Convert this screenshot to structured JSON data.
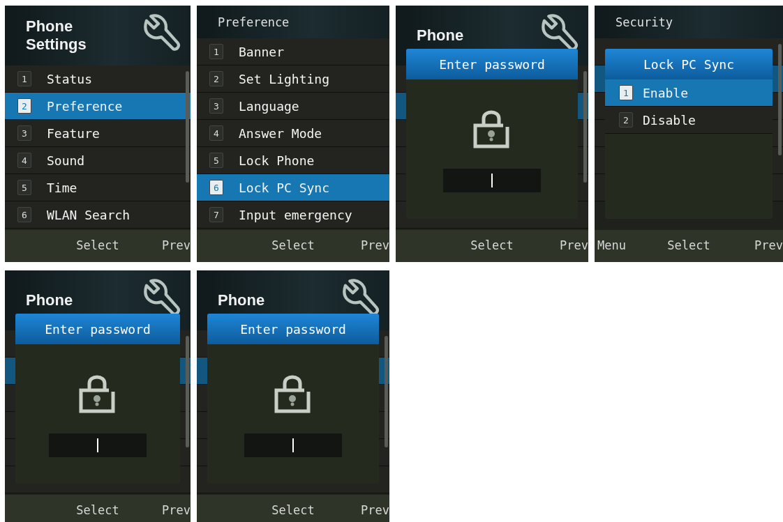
{
  "screens": [
    {
      "kind": "menu",
      "title": "Phone Settings",
      "wrench": true,
      "scrollbar": true,
      "items": [
        {
          "number": "1",
          "label": "Status",
          "selected": false
        },
        {
          "number": "2",
          "label": "Preference",
          "selected": true
        },
        {
          "number": "3",
          "label": "Feature",
          "selected": false
        },
        {
          "number": "4",
          "label": "Sound",
          "selected": false
        },
        {
          "number": "5",
          "label": "Time",
          "selected": false
        },
        {
          "number": "6",
          "label": "WLAN Search",
          "selected": false
        }
      ],
      "softkeys": {
        "center": "Select",
        "right": "Prev"
      }
    },
    {
      "kind": "menu",
      "title": "Preference",
      "wrench": false,
      "scrollbar": false,
      "items": [
        {
          "number": "1",
          "label": "Banner",
          "selected": false
        },
        {
          "number": "2",
          "label": "Set Lighting",
          "selected": false
        },
        {
          "number": "3",
          "label": "Language",
          "selected": false
        },
        {
          "number": "4",
          "label": "Answer Mode",
          "selected": false
        },
        {
          "number": "5",
          "label": "Lock Phone",
          "selected": false
        },
        {
          "number": "6",
          "label": "Lock PC Sync",
          "selected": true
        },
        {
          "number": "7",
          "label": "Input emergency",
          "selected": false
        }
      ],
      "softkeys": {
        "center": "Select",
        "right": "Prev"
      }
    },
    {
      "kind": "password",
      "title": "Phone",
      "wrench": true,
      "scrollbar": true,
      "dialog": {
        "title": "Enter password"
      },
      "softkeys": {
        "center": "Select",
        "right": "Prev"
      }
    },
    {
      "kind": "options",
      "title": "Security",
      "wrench": false,
      "scrollbar": true,
      "dialog": {
        "title": "Lock PC Sync",
        "options": [
          {
            "number": "1",
            "label": "Enable",
            "selected": true
          },
          {
            "number": "2",
            "label": "Disable",
            "selected": false
          }
        ]
      },
      "softkeys": {
        "left": "Menu",
        "center": "Select",
        "right": "Prev"
      }
    },
    {
      "kind": "password",
      "title": "Phone",
      "wrench": true,
      "scrollbar": true,
      "dialog": {
        "title": "Enter password"
      },
      "softkeys": {
        "center": "Select",
        "right": "Prev"
      }
    },
    {
      "kind": "password",
      "title": "Phone",
      "wrench": true,
      "scrollbar": true,
      "dialog": {
        "title": "Enter password"
      },
      "softkeys": {
        "center": "Select",
        "right": "Prev"
      }
    }
  ]
}
